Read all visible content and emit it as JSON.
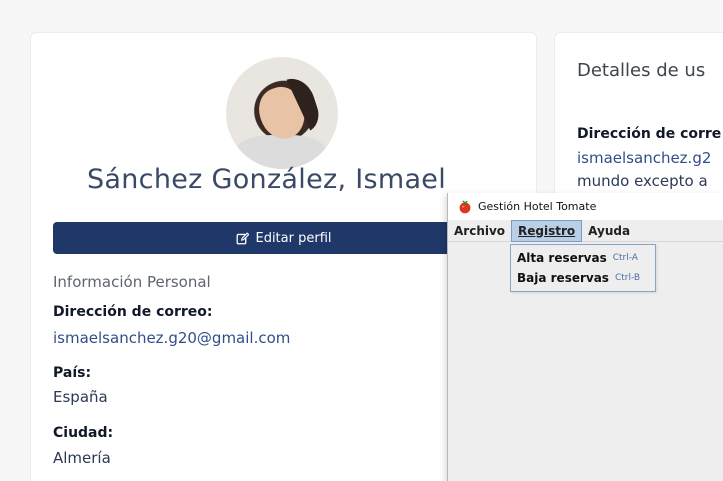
{
  "profile": {
    "name": "Sánchez González, Ismael",
    "edit_button_label": "Editar perfil",
    "section_title": "Información Personal",
    "fields": [
      {
        "label": "Dirección de correo:",
        "value": "ismaelsanchez.g20@gmail.com"
      },
      {
        "label": "País:",
        "value": "España"
      },
      {
        "label": "Ciudad:",
        "value": "Almería"
      }
    ]
  },
  "details": {
    "title": "Detalles de us",
    "label": "Dirección de corre",
    "email": "ismaelsanchez.g2",
    "text": "mundo excepto a"
  },
  "app_window": {
    "title": "Gestión Hotel Tomate",
    "menus": [
      "Archivo",
      "Registro",
      "Ayuda"
    ],
    "active_menu": "Registro",
    "dropdown": [
      {
        "label": "Alta reservas",
        "accelerator": "Ctrl-A"
      },
      {
        "label": "Baja reservas",
        "accelerator": "Ctrl-B"
      }
    ]
  },
  "colors": {
    "primary_button": "#1f3869",
    "link": "#314e8a",
    "menu_highlight": "#b8cfe5",
    "tomato": "#d9381e"
  },
  "icons": {
    "edit": "edit-icon",
    "app": "tomato-icon"
  }
}
